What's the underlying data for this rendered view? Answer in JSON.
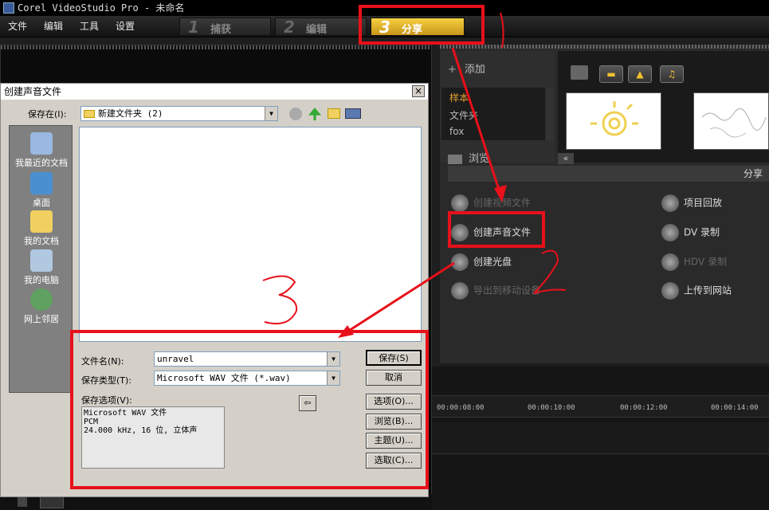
{
  "title": "Corel VideoStudio Pro - 未命名",
  "menu": [
    "文件",
    "编辑",
    "工具",
    "设置"
  ],
  "steps": [
    {
      "num": "1",
      "label": "捕获"
    },
    {
      "num": "2",
      "label": "编辑"
    },
    {
      "num": "3",
      "label": "分享"
    }
  ],
  "library": {
    "add_label": "添加",
    "list": [
      "样本",
      "文件夹",
      "fox"
    ],
    "browse_label": "浏览",
    "share_header": "分享",
    "share_items_left": [
      "创建视频文件",
      "创建声音文件",
      "创建光盘",
      "导出到移动设备"
    ],
    "share_items_right": [
      "项目回放",
      "DV 录制",
      "HDV 录制",
      "上传到网站"
    ]
  },
  "timeline": {
    "ticks": [
      "00:00:08:00",
      "00:00:10:00",
      "00:00:12:00",
      "00:00:14:00"
    ]
  },
  "dialog": {
    "title": "创建声音文件",
    "save_in_label": "保存在(I):",
    "save_in_value": "新建文件夹 (2)",
    "places": [
      "我最近的文档",
      "桌面",
      "我的文档",
      "我的电脑",
      "网上邻居"
    ],
    "filename_label": "文件名(N):",
    "filename_value": "unravel",
    "filetype_label": "保存类型(T):",
    "filetype_value": "Microsoft WAV 文件 (*.wav)",
    "options_label": "保存选项(V):",
    "options_text": [
      "Microsoft WAV 文件",
      "PCM",
      "24.000 kHz, 16 位, 立体声"
    ],
    "buttons": [
      "保存(S)",
      "取消",
      "选项(O)...",
      "浏览(B)...",
      "主题(U)...",
      "选取(C)..."
    ]
  },
  "annotations": [
    "1",
    "2",
    "3"
  ]
}
